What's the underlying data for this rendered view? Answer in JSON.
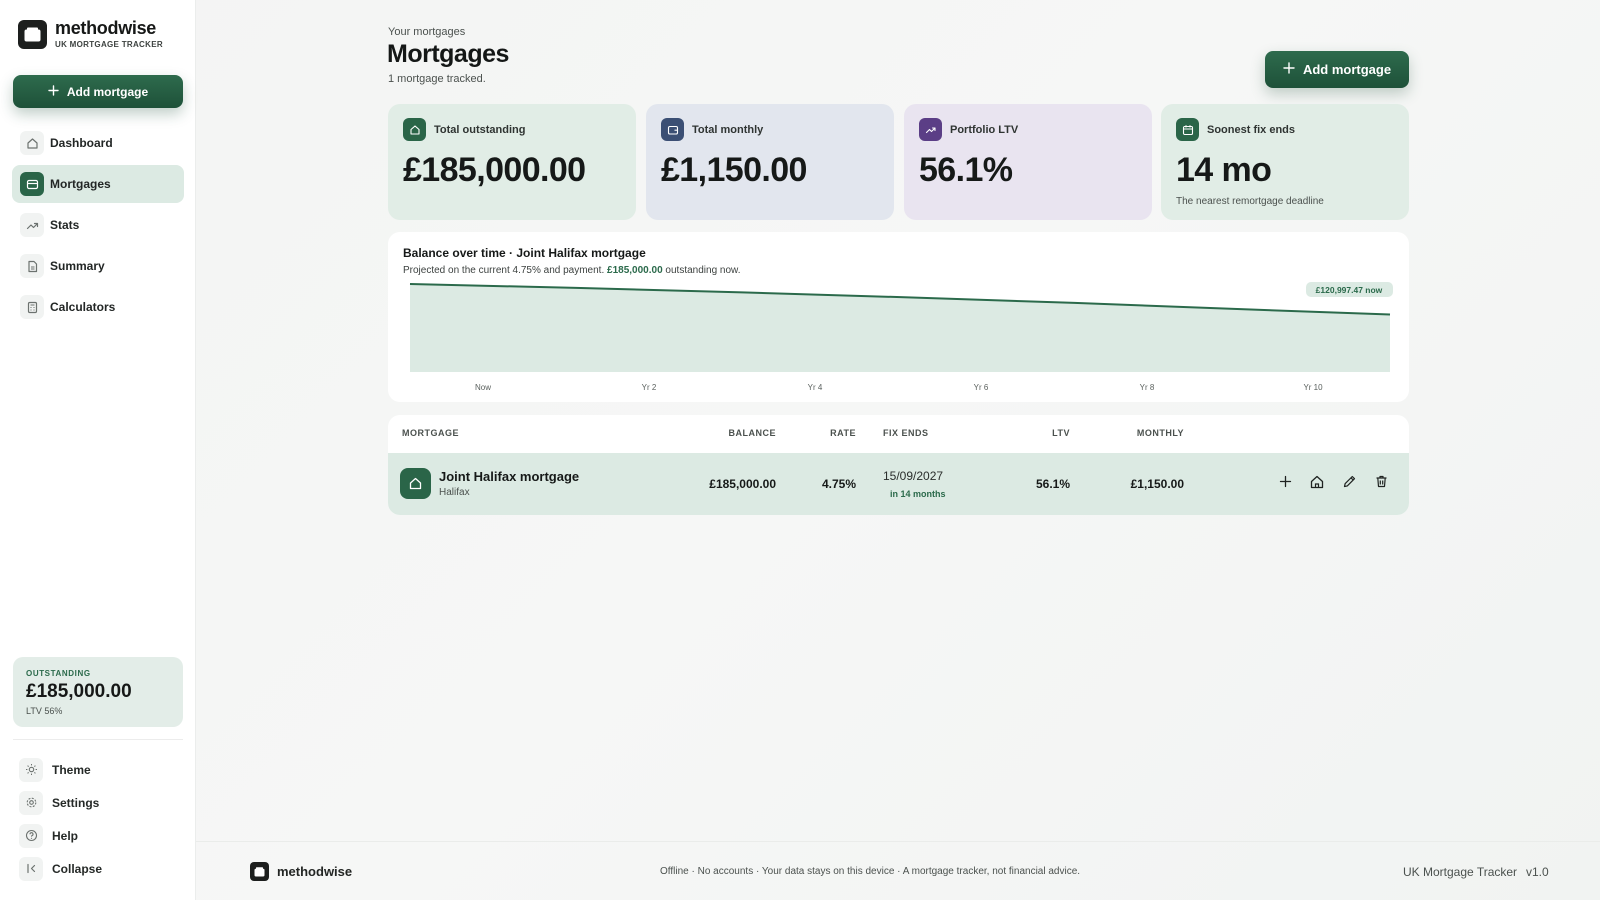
{
  "brand": {
    "name": "methodwise",
    "subtitle": "UK MORTGAGE TRACKER"
  },
  "sidebar": {
    "add_label": "Add mortgage",
    "nav": [
      {
        "label": "Dashboard",
        "icon": "home-icon"
      },
      {
        "label": "Mortgages",
        "icon": "card-icon",
        "active": true
      },
      {
        "label": "Stats",
        "icon": "trend-icon"
      },
      {
        "label": "Summary",
        "icon": "document-icon"
      },
      {
        "label": "Calculators",
        "icon": "calculator-icon"
      }
    ],
    "card": {
      "label": "OUTSTANDING",
      "value": "£185,000.00",
      "sub": "LTV 56%"
    },
    "bottom": [
      {
        "label": "Theme",
        "icon": "sun-icon"
      },
      {
        "label": "Settings",
        "icon": "gear-icon"
      },
      {
        "label": "Help",
        "icon": "help-icon"
      },
      {
        "label": "Collapse",
        "icon": "collapse-icon"
      }
    ]
  },
  "header": {
    "eyebrow": "Your mortgages",
    "title": "Mortgages",
    "subtitle": "1 mortgage tracked.",
    "add_label": "Add mortgage"
  },
  "stats": [
    {
      "label": "Total outstanding",
      "value": "£185,000.00",
      "sub": "",
      "icon": "home-icon",
      "bg": "#e1ede6",
      "icon_bg": "#2a6548"
    },
    {
      "label": "Total monthly",
      "value": "£1,150.00",
      "sub": "",
      "icon": "wallet-icon",
      "bg": "#e2e6ee",
      "icon_bg": "#3b4f74"
    },
    {
      "label": "Portfolio LTV",
      "value": "56.1%",
      "sub": "",
      "icon": "trend-icon",
      "bg": "#e9e4f0",
      "icon_bg": "#5b3e86"
    },
    {
      "label": "Soonest fix ends",
      "value": "14 mo",
      "sub": "The nearest remortgage deadline",
      "icon": "calendar-icon",
      "bg": "#e1ede6",
      "icon_bg": "#2a6548"
    }
  ],
  "chart": {
    "title": "Balance over time · Joint Halifax mortgage",
    "subtitle_prefix": "Projected on the current 4.75% and payment. ",
    "subtitle_highlight": "£185,000.00",
    "subtitle_suffix": " outstanding now.",
    "end_badge": "£120,997.47 now",
    "line_color": "#2b6a4b",
    "fill_color": "#dceae3"
  },
  "chart_data": {
    "type": "area",
    "title": "Balance over time · Joint Halifax mortgage",
    "x_ticks": [
      "Now",
      "Yr 2",
      "Yr 4",
      "Yr 6",
      "Yr 8",
      "Yr 10"
    ],
    "x_range": [
      0,
      11.8
    ],
    "series": [
      {
        "x": [
          0,
          2,
          4,
          6,
          8,
          10,
          11.8
        ],
        "values": [
          185000,
          176800,
          167400,
          156900,
          145200,
          132100,
          120997.47
        ]
      }
    ],
    "ylim": [
      0,
      185000
    ],
    "grid": false
  },
  "table": {
    "headers": {
      "mortgage": "MORTGAGE",
      "balance": "BALANCE",
      "rate": "RATE",
      "fix": "FIX ENDS",
      "ltv": "LTV",
      "monthly": "MONTHLY"
    },
    "rows": [
      {
        "name": "Joint Halifax mortgage",
        "lender": "Halifax",
        "balance": "£185,000.00",
        "rate": "4.75%",
        "fix_date": "15/09/2027",
        "fix_badge": "in 14 months",
        "ltv": "56.1%",
        "monthly": "£1,150.00"
      }
    ]
  },
  "footer": {
    "brand": "methodwise",
    "note": "Offline · No accounts · Your data stays on this device · A mortgage tracker, not financial advice.",
    "product": "UK Mortgage Tracker",
    "version": "v1.0"
  }
}
